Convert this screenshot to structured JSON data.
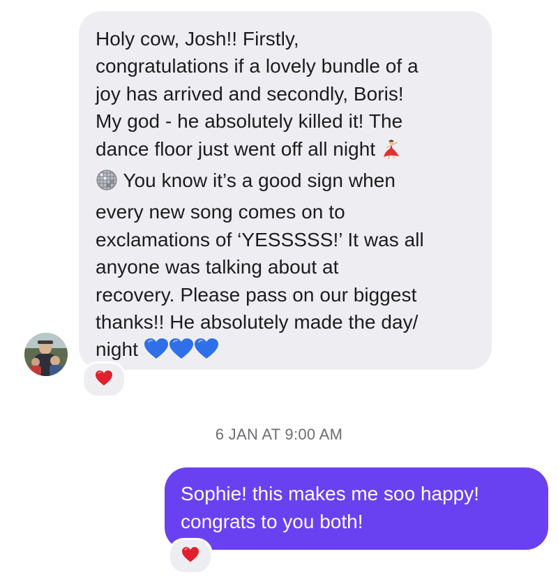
{
  "incoming": {
    "lines": [
      "Holy cow, Josh!! Firstly,",
      "congratulations if a lovely bundle of a",
      "joy has arrived and secondly, Boris!",
      "My god - he absolutely killed it! The",
      "dance floor just went off all night",
      "You know it’s a good sign when",
      "every new song comes on to",
      "exclamations of ‘YESSSSS!’ It was all",
      "anyone was talking about at",
      "recovery. Please pass on our biggest",
      "thanks!! He absolutely made the day/",
      "night"
    ],
    "emojis_after_line_5": [
      "dancer-emoji"
    ],
    "emojis_before_line_6": [
      "disco-ball-emoji"
    ],
    "emojis_after_line_12": [
      "blue-heart-emoji",
      "blue-heart-emoji",
      "blue-heart-emoji"
    ],
    "reaction": "red-heart-emoji"
  },
  "timestamp": "6 JAN AT 9:00 AM",
  "outgoing": {
    "lines": [
      "Sophie! this makes me soo happy!",
      "congrats to you both!"
    ],
    "reaction": "red-heart-emoji"
  },
  "colors": {
    "incoming_bubble": "#eeeef2",
    "outgoing_bubble": "#6a41f0",
    "timestamp_text": "#6d6d72",
    "heart_red": "#e0202e",
    "heart_blue": "#2f6fe8"
  }
}
